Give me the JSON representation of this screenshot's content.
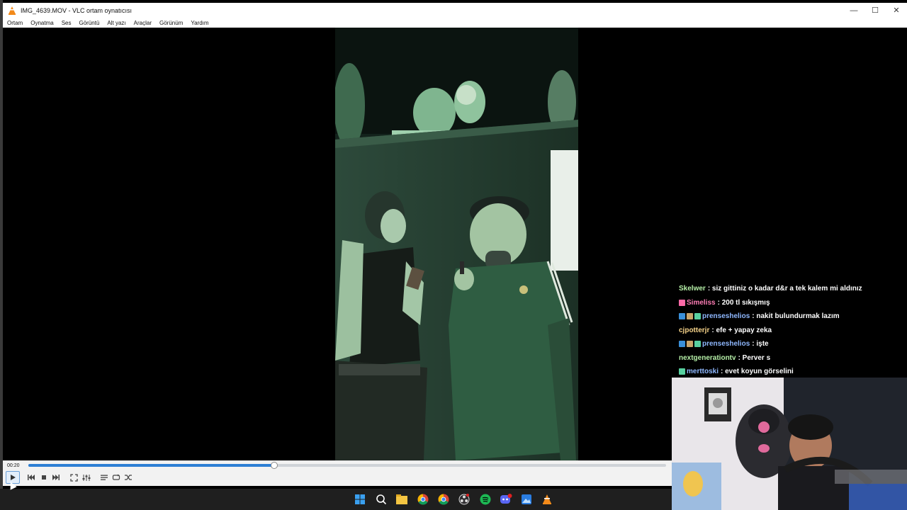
{
  "window": {
    "title": "IMG_4639.MOV - VLC ortam oynatıcısı",
    "minimize": "—",
    "maximize": "☐",
    "close": "✕"
  },
  "menu": [
    "Ortam",
    "Oynatma",
    "Ses",
    "Görüntü",
    "Alt yazı",
    "Araçlar",
    "Görünüm",
    "Yardım"
  ],
  "player": {
    "elapsed": "00:20",
    "progress": 0.385,
    "icons": [
      "play-icon",
      "previous-icon",
      "stop-icon",
      "next-icon",
      "fullscreen-icon",
      "extended-settings-icon",
      "playlist-icon",
      "loop-icon",
      "shuffle-icon"
    ]
  },
  "chat": [
    {
      "user": "Skelwer",
      "color": "#b6f0a8",
      "badges": [],
      "msg": ": siz gittiniz o kadar d&r a tek kalem mi aldınız"
    },
    {
      "user": "Simeliss",
      "color": "#ff7eb6",
      "badges": [
        "#ff6aa8"
      ],
      "msg": ": 200 tl sıkışmış"
    },
    {
      "user": "prenseshelios",
      "color": "#8fb8ff",
      "badges": [
        "#3a8fd8",
        "#c9a46a",
        "#58d0a0"
      ],
      "msg": ": nakit bulundurmak lazım"
    },
    {
      "user": "cjpotterjr",
      "color": "#f7d48a",
      "badges": [],
      "msg": ": efe + yapay zeka"
    },
    {
      "user": "prenseshelios",
      "color": "#8fb8ff",
      "badges": [
        "#3a8fd8",
        "#c9a46a",
        "#58d0a0"
      ],
      "msg": ": işte"
    },
    {
      "user": "nextgenerationtv",
      "color": "#b6f0a8",
      "badges": [],
      "msg": ": Perver s"
    },
    {
      "user": "merttoski",
      "color": "#8fb8ff",
      "badges": [
        "#58d0a0"
      ],
      "msg": ": evet koyun görselini"
    }
  ],
  "taskbar": {
    "icons": [
      "windows-start-icon",
      "search-icon",
      "file-explorer-icon",
      "chrome-icon",
      "chrome-icon-2",
      "obs-icon",
      "spotify-icon",
      "discord-icon",
      "photos-icon",
      "vlc-icon"
    ],
    "discord_badge": "94"
  }
}
